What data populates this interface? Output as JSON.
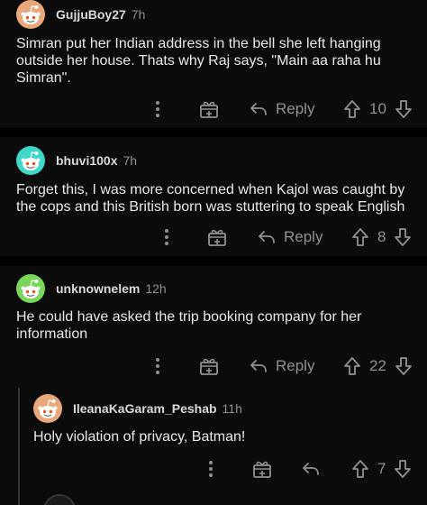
{
  "comments": [
    {
      "username": "GujjuBoy27",
      "time": "7h",
      "avatar_color": "#e8a87c",
      "text": "Simran put her Indian address in the bell she left hanging outside her house. Thats why Raj says, \"Main aa raha hu Simran\".",
      "reply_label": "Reply",
      "votes": "10"
    },
    {
      "username": "bhuvi100x",
      "time": "7h",
      "avatar_color": "#3ed7c9",
      "text": "Forget this, I was more concerned when Kajol was caught by the cops and this British born was stuttering to speak English",
      "reply_label": "Reply",
      "votes": "8"
    },
    {
      "username": "unknownelem",
      "time": "12h",
      "avatar_color": "#78d65a",
      "text": "He could have asked the trip booking company for her information",
      "reply_label": "Reply",
      "votes": "22"
    },
    {
      "username": "IleanaKaGaram_Peshab",
      "time": "11h",
      "avatar_color": "#e8a87c",
      "text": "Holy violation of privacy, Batman!",
      "votes": "7"
    }
  ],
  "icons": {
    "more": "more-options-icon",
    "award": "award-icon",
    "reply": "reply-arrow-icon",
    "upvote": "upvote-arrow-icon",
    "downvote": "downvote-arrow-icon",
    "avatar": "snoo-avatar-icon"
  },
  "colors": {
    "background": "#000000",
    "card": "#0b0b0b",
    "text": "#e8e8e8",
    "meta": "#8e9194"
  }
}
